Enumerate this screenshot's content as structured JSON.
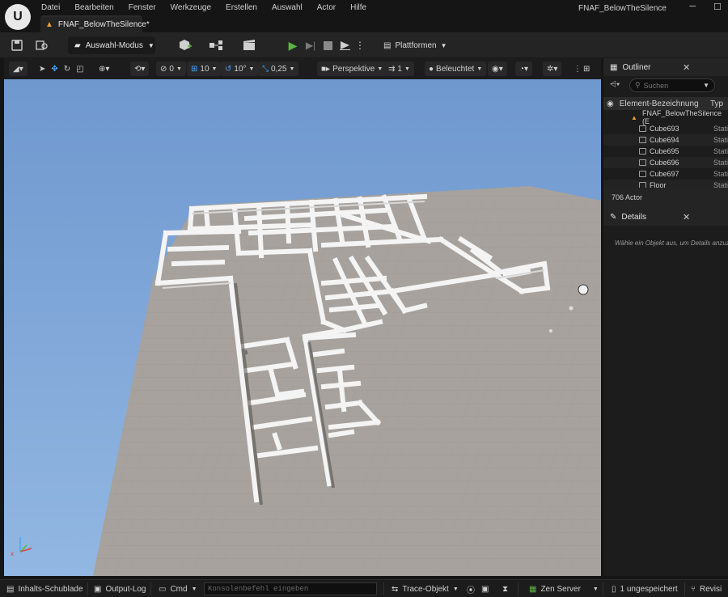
{
  "app": {
    "window_title": "FNAF_BelowTheSilence",
    "logo_text": "U",
    "menu": [
      "Datei",
      "Bearbeiten",
      "Fenster",
      "Werkzeuge",
      "Erstellen",
      "Auswahl",
      "Actor",
      "Hilfe"
    ],
    "doc_tab": "FNAF_BelowTheSilence*"
  },
  "toolbar": {
    "mode": "Auswahl-Modus",
    "platforms": "Plattformen"
  },
  "viewport_toolbar": {
    "rotation_snap": "0",
    "grid_snap": "10",
    "angle_snap": "10°",
    "scale_snap": "0,25",
    "view_mode": "Perspektive",
    "camera_speed": "1",
    "lighting": "Beleuchtet"
  },
  "outliner": {
    "title": "Outliner",
    "search_placeholder": "Suchen",
    "col_label": "Element-Bezeichnung",
    "col_type": "Typ",
    "root": "FNAF_BelowTheSilence (E",
    "items": [
      {
        "name": "Cube693",
        "type": "Stati"
      },
      {
        "name": "Cube694",
        "type": "Stati"
      },
      {
        "name": "Cube695",
        "type": "Stati"
      },
      {
        "name": "Cube696",
        "type": "Stati"
      },
      {
        "name": "Cube697",
        "type": "Stati"
      },
      {
        "name": "Floor",
        "type": "Stati"
      }
    ],
    "count": "706 Actor"
  },
  "details": {
    "title": "Details",
    "hint": "Wähle ein Objekt aus, um Details anzuz"
  },
  "status": {
    "content_drawer": "Inhalts-Schublade",
    "output_log": "Output-Log",
    "cmd": "Cmd",
    "console_placeholder": "Konsolenbefehl eingeben",
    "trace": "Trace-Objekt",
    "zen": "Zen Server",
    "unsaved": "1 ungespeichert",
    "revision": "Revisi"
  },
  "colors": {
    "sky": "#7ea5d6",
    "floor": "#a7a29d",
    "walls": "#f2f2f2",
    "play_green": "#5bb543",
    "tab_accent": "#e8a03a"
  }
}
